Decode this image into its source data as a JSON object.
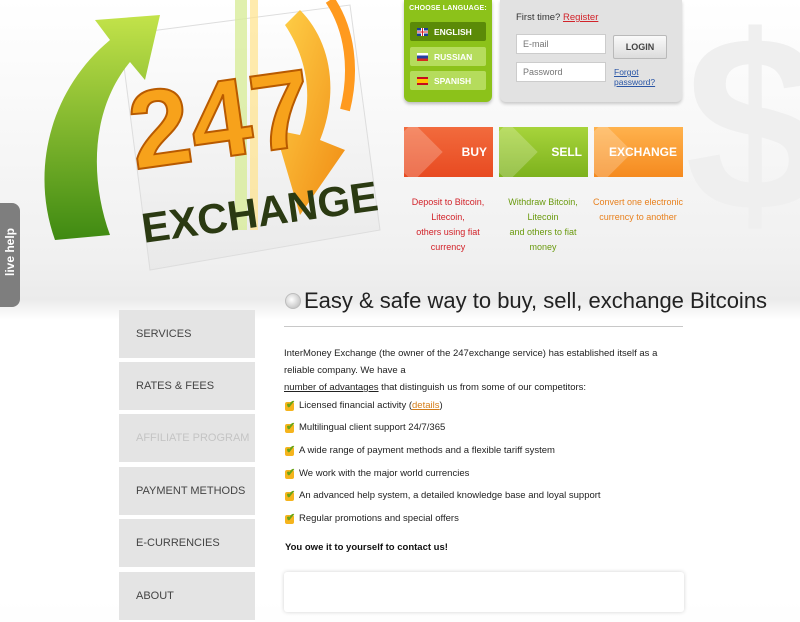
{
  "logo": {
    "number": "247",
    "word": "EXCHANGE"
  },
  "language": {
    "title": "CHOOSE LANGUAGE:",
    "options": [
      {
        "label": "ENGLISH",
        "flag": "uk-flag-icon",
        "active": true
      },
      {
        "label": "RUSSIAN",
        "flag": "russia-flag-icon",
        "active": false
      },
      {
        "label": "SPANISH",
        "flag": "spain-flag-icon",
        "active": false
      }
    ]
  },
  "login": {
    "first_time": "First time?",
    "register": "Register",
    "email_placeholder": "E-mail",
    "password_placeholder": "Password",
    "button": "LOGIN",
    "forgot": "Forgot password?"
  },
  "actions": {
    "buy": {
      "label": "BUY",
      "desc_1": "Deposit to Bitcoin, Litecoin,",
      "desc_2": "others using fiat currency"
    },
    "sell": {
      "label": "SELL",
      "desc_1": "Withdraw Bitcoin, Litecoin",
      "desc_2": "and others to fiat money"
    },
    "exchange": {
      "label": "EXCHANGE",
      "desc_1": "Convert one electronic",
      "desc_2": "currency to another"
    }
  },
  "live_help": "live help",
  "sidebar": {
    "items": [
      {
        "label": "SERVICES"
      },
      {
        "label": "RATES & FEES"
      },
      {
        "label": "AFFILIATE PROGRAM"
      },
      {
        "label": "PAYMENT METHODS"
      },
      {
        "label": "E-CURRENCIES"
      },
      {
        "label": "ABOUT"
      }
    ]
  },
  "main": {
    "headline": "Easy & safe way to buy, sell, exchange Bitcoins",
    "intro_1": "InterMoney Exchange (the owner of the 247exchange service) has established itself as a reliable company. We have a",
    "intro_link": "number of advantages",
    "intro_2": " that distinguish us from some of our competitors:",
    "features": [
      "Licensed financial activity (",
      "Multilingual client support 24/7/365",
      "A wide range of payment methods and a flexible tariff system",
      "We work with the major world currencies",
      "An advanced help system, a detailed knowledge base and loyal support",
      "Regular promotions and special offers"
    ],
    "details_link": "details",
    "details_close": ")",
    "contact_note": "You owe it to yourself to contact us!"
  },
  "colors": {
    "brand_green": "#8cc21a",
    "buy_red": "#e84a21",
    "sell_green": "#7db21d",
    "exchange_orange": "#f58a1f",
    "link_red": "#d2232a"
  }
}
